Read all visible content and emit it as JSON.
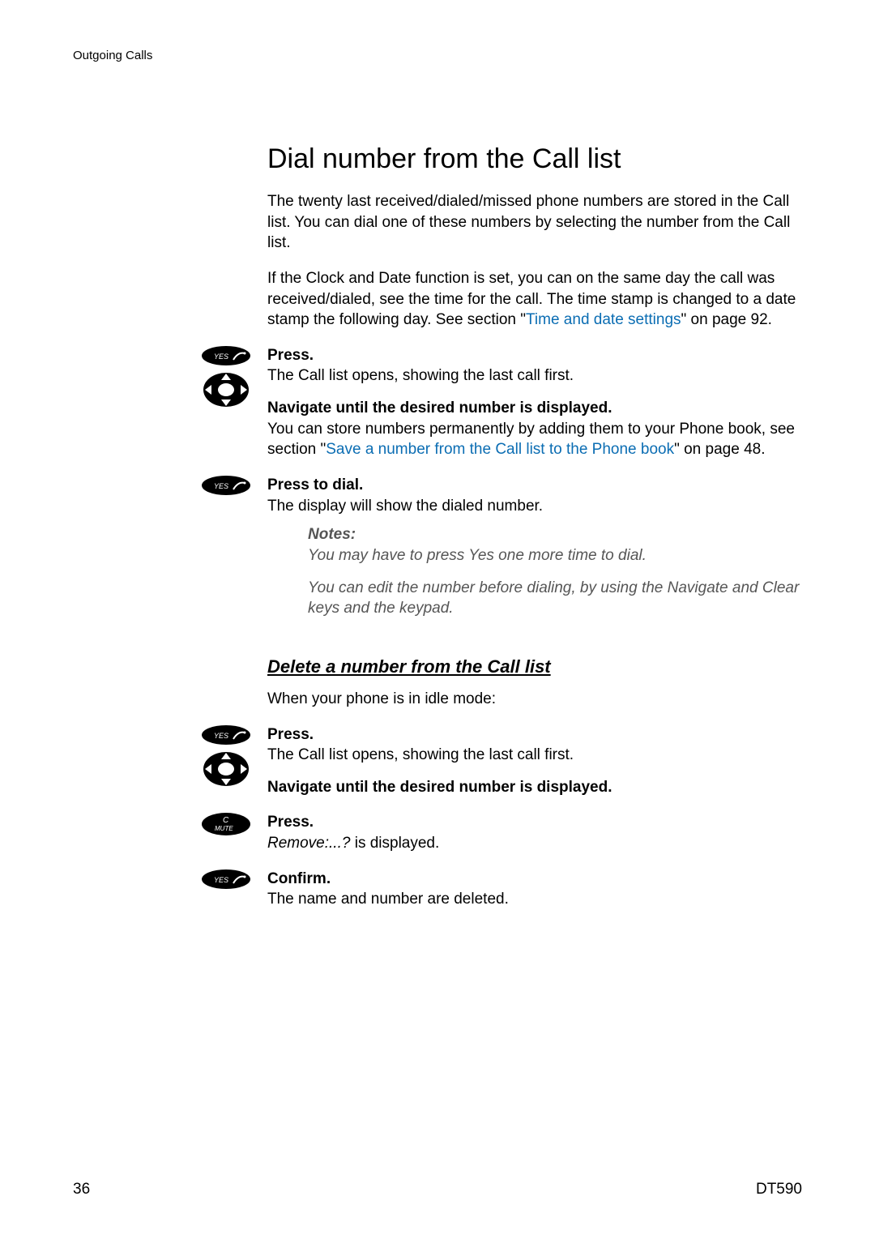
{
  "header": {
    "section": "Outgoing Calls"
  },
  "title": "Dial number from the Call list",
  "intro1": "The twenty last received/dialed/missed phone numbers are stored in the Call list. You can dial one of these numbers by selecting the number from the Call list.",
  "intro2a": "If the Clock and Date function is set, you can on the same day the call was received/dialed, see the time for the call. The time stamp is changed to a date stamp the following day. See section \"",
  "intro2_link": "Time and date settings",
  "intro2b": "\" on page 92.",
  "step1": {
    "action": "Press.",
    "body": "The Call list opens, showing the last call first."
  },
  "step2": {
    "action": "Navigate until the desired number is displayed.",
    "body_a": "You can store numbers permanently by adding them to your Phone book, see section \"",
    "body_link": "Save a number from the Call list to the Phone book",
    "body_b": "\" on page 48."
  },
  "step3": {
    "action": "Press to dial.",
    "body": "The display will show the dialed number."
  },
  "notes": {
    "label": "Notes:",
    "n1": "You may have to press Yes one more time to dial.",
    "n2": "You can edit the number before dialing, by using the Navigate and Clear keys and the keypad."
  },
  "subhead": "Delete a number from the Call list",
  "sub_intro": "When your phone is in idle mode:",
  "d1": {
    "action": "Press.",
    "body": "The Call list opens, showing the last call first."
  },
  "d2": {
    "action": "Navigate until the desired number is displayed."
  },
  "d3": {
    "action": "Press.",
    "body_italic": "Remove:...?",
    "body_rest": " is displayed."
  },
  "d4": {
    "action": "Confirm.",
    "body": "The name and number are deleted."
  },
  "footer": {
    "page": "36",
    "model": "DT590"
  },
  "icons": {
    "yes_label": "YES",
    "mute_top": "C",
    "mute_bottom": "MUTE"
  }
}
